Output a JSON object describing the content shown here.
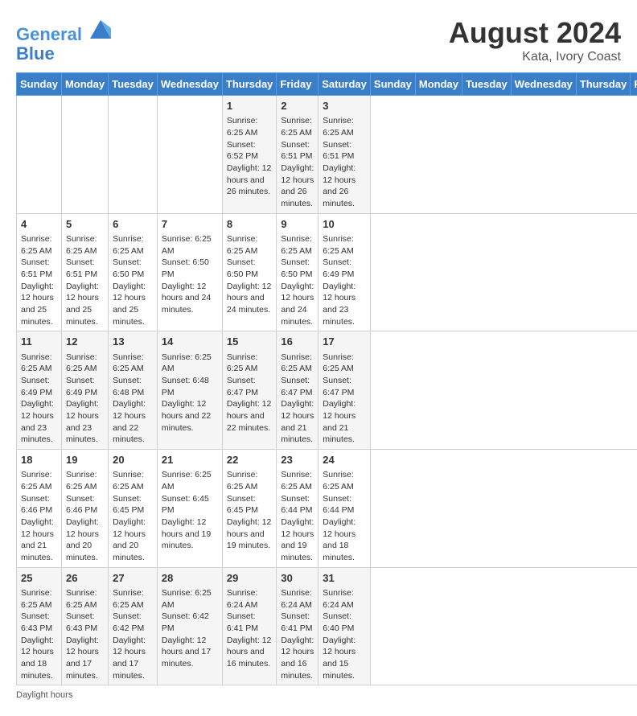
{
  "header": {
    "logo_line1": "General",
    "logo_line2": "Blue",
    "month_year": "August 2024",
    "location": "Kata, Ivory Coast"
  },
  "days_of_week": [
    "Sunday",
    "Monday",
    "Tuesday",
    "Wednesday",
    "Thursday",
    "Friday",
    "Saturday"
  ],
  "weeks": [
    [
      {
        "day": "",
        "info": ""
      },
      {
        "day": "",
        "info": ""
      },
      {
        "day": "",
        "info": ""
      },
      {
        "day": "",
        "info": ""
      },
      {
        "day": "1",
        "info": "Sunrise: 6:25 AM\nSunset: 6:52 PM\nDaylight: 12 hours and 26 minutes."
      },
      {
        "day": "2",
        "info": "Sunrise: 6:25 AM\nSunset: 6:51 PM\nDaylight: 12 hours and 26 minutes."
      },
      {
        "day": "3",
        "info": "Sunrise: 6:25 AM\nSunset: 6:51 PM\nDaylight: 12 hours and 26 minutes."
      }
    ],
    [
      {
        "day": "4",
        "info": "Sunrise: 6:25 AM\nSunset: 6:51 PM\nDaylight: 12 hours and 25 minutes."
      },
      {
        "day": "5",
        "info": "Sunrise: 6:25 AM\nSunset: 6:51 PM\nDaylight: 12 hours and 25 minutes."
      },
      {
        "day": "6",
        "info": "Sunrise: 6:25 AM\nSunset: 6:50 PM\nDaylight: 12 hours and 25 minutes."
      },
      {
        "day": "7",
        "info": "Sunrise: 6:25 AM\nSunset: 6:50 PM\nDaylight: 12 hours and 24 minutes."
      },
      {
        "day": "8",
        "info": "Sunrise: 6:25 AM\nSunset: 6:50 PM\nDaylight: 12 hours and 24 minutes."
      },
      {
        "day": "9",
        "info": "Sunrise: 6:25 AM\nSunset: 6:50 PM\nDaylight: 12 hours and 24 minutes."
      },
      {
        "day": "10",
        "info": "Sunrise: 6:25 AM\nSunset: 6:49 PM\nDaylight: 12 hours and 23 minutes."
      }
    ],
    [
      {
        "day": "11",
        "info": "Sunrise: 6:25 AM\nSunset: 6:49 PM\nDaylight: 12 hours and 23 minutes."
      },
      {
        "day": "12",
        "info": "Sunrise: 6:25 AM\nSunset: 6:49 PM\nDaylight: 12 hours and 23 minutes."
      },
      {
        "day": "13",
        "info": "Sunrise: 6:25 AM\nSunset: 6:48 PM\nDaylight: 12 hours and 22 minutes."
      },
      {
        "day": "14",
        "info": "Sunrise: 6:25 AM\nSunset: 6:48 PM\nDaylight: 12 hours and 22 minutes."
      },
      {
        "day": "15",
        "info": "Sunrise: 6:25 AM\nSunset: 6:47 PM\nDaylight: 12 hours and 22 minutes."
      },
      {
        "day": "16",
        "info": "Sunrise: 6:25 AM\nSunset: 6:47 PM\nDaylight: 12 hours and 21 minutes."
      },
      {
        "day": "17",
        "info": "Sunrise: 6:25 AM\nSunset: 6:47 PM\nDaylight: 12 hours and 21 minutes."
      }
    ],
    [
      {
        "day": "18",
        "info": "Sunrise: 6:25 AM\nSunset: 6:46 PM\nDaylight: 12 hours and 21 minutes."
      },
      {
        "day": "19",
        "info": "Sunrise: 6:25 AM\nSunset: 6:46 PM\nDaylight: 12 hours and 20 minutes."
      },
      {
        "day": "20",
        "info": "Sunrise: 6:25 AM\nSunset: 6:45 PM\nDaylight: 12 hours and 20 minutes."
      },
      {
        "day": "21",
        "info": "Sunrise: 6:25 AM\nSunset: 6:45 PM\nDaylight: 12 hours and 19 minutes."
      },
      {
        "day": "22",
        "info": "Sunrise: 6:25 AM\nSunset: 6:45 PM\nDaylight: 12 hours and 19 minutes."
      },
      {
        "day": "23",
        "info": "Sunrise: 6:25 AM\nSunset: 6:44 PM\nDaylight: 12 hours and 19 minutes."
      },
      {
        "day": "24",
        "info": "Sunrise: 6:25 AM\nSunset: 6:44 PM\nDaylight: 12 hours and 18 minutes."
      }
    ],
    [
      {
        "day": "25",
        "info": "Sunrise: 6:25 AM\nSunset: 6:43 PM\nDaylight: 12 hours and 18 minutes."
      },
      {
        "day": "26",
        "info": "Sunrise: 6:25 AM\nSunset: 6:43 PM\nDaylight: 12 hours and 17 minutes."
      },
      {
        "day": "27",
        "info": "Sunrise: 6:25 AM\nSunset: 6:42 PM\nDaylight: 12 hours and 17 minutes."
      },
      {
        "day": "28",
        "info": "Sunrise: 6:25 AM\nSunset: 6:42 PM\nDaylight: 12 hours and 17 minutes."
      },
      {
        "day": "29",
        "info": "Sunrise: 6:24 AM\nSunset: 6:41 PM\nDaylight: 12 hours and 16 minutes."
      },
      {
        "day": "30",
        "info": "Sunrise: 6:24 AM\nSunset: 6:41 PM\nDaylight: 12 hours and 16 minutes."
      },
      {
        "day": "31",
        "info": "Sunrise: 6:24 AM\nSunset: 6:40 PM\nDaylight: 12 hours and 15 minutes."
      }
    ]
  ],
  "footer": {
    "text": "Daylight hours"
  }
}
